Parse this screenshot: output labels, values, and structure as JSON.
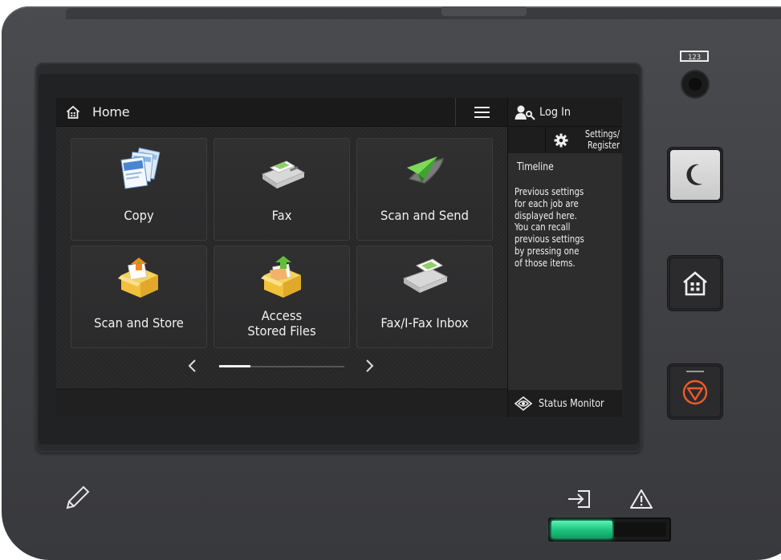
{
  "device": {
    "counter_label": "123"
  },
  "header": {
    "title": "Home"
  },
  "tiles": [
    {
      "label": "Copy"
    },
    {
      "label": "Fax"
    },
    {
      "label": "Scan and Send"
    },
    {
      "label": "Scan and Store"
    },
    {
      "label_line1": "Access",
      "label_line2": "Stored Files"
    },
    {
      "label": "Fax/I-Fax Inbox"
    }
  ],
  "pager": {
    "page_progress": 0.25
  },
  "sidebar": {
    "login_label": "Log In",
    "settings_line1": "Settings/",
    "settings_line2": "Register",
    "timeline_title": "Timeline",
    "timeline_lines": [
      "Previous settings",
      "for each job are",
      "displayed here.",
      "You can recall",
      "previous settings",
      "by pressing one",
      "of those items."
    ],
    "status_monitor_label": "Status Monitor"
  },
  "colors": {
    "energy_saver_face": "#d9d9d9",
    "stop_accent": "#f05a28",
    "data_led": "#1fc582"
  },
  "icons": [
    "home-icon",
    "menu-icon",
    "login-icon",
    "gear-icon",
    "chevron-left-icon",
    "chevron-right-icon",
    "status-monitor-icon",
    "moon-icon",
    "stop-icon",
    "pencil-icon",
    "processing-data-icon",
    "error-icon"
  ]
}
